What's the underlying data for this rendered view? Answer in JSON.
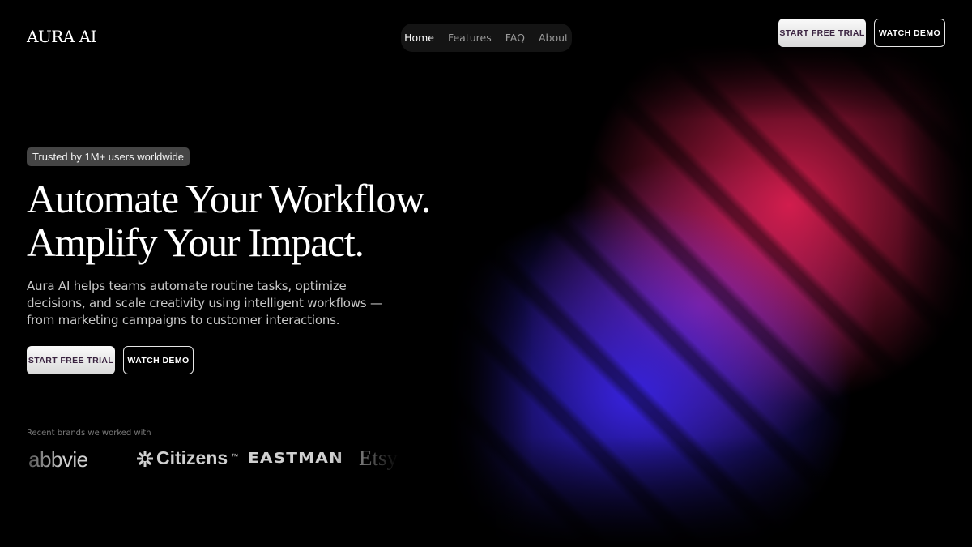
{
  "header": {
    "logo": "AURA AI",
    "nav": [
      {
        "label": "Home",
        "active": true
      },
      {
        "label": "Features",
        "active": false
      },
      {
        "label": "FAQ",
        "active": false
      },
      {
        "label": "About",
        "active": false
      }
    ],
    "cta_primary": "START FREE TRIAL",
    "cta_secondary": "WATCH DEMO"
  },
  "hero": {
    "badge": "Trusted by 1M+ users worldwide",
    "headline_line1": "Automate Your Workflow.",
    "headline_line2": "Amplify Your Impact.",
    "description": "Aura AI helps teams automate routine tasks, optimize decisions, and scale creativity using intelligent workflows — from marketing campaigns to customer interactions.",
    "cta_primary": "START FREE TRIAL",
    "cta_secondary": "WATCH DEMO"
  },
  "brands": {
    "label": "Recent brands we worked with",
    "items": [
      {
        "name": "abbvie"
      },
      {
        "name": "Citizens",
        "trademark": "™"
      },
      {
        "name": "EASTMAN"
      },
      {
        "name": "Etsy"
      }
    ]
  },
  "colors": {
    "background": "#000000",
    "gradient_blue": "#3723e6",
    "gradient_red": "#dc1e50",
    "gradient_purple": "#9628aa",
    "nav_pill": "#141414",
    "badge_bg": "#454545"
  }
}
